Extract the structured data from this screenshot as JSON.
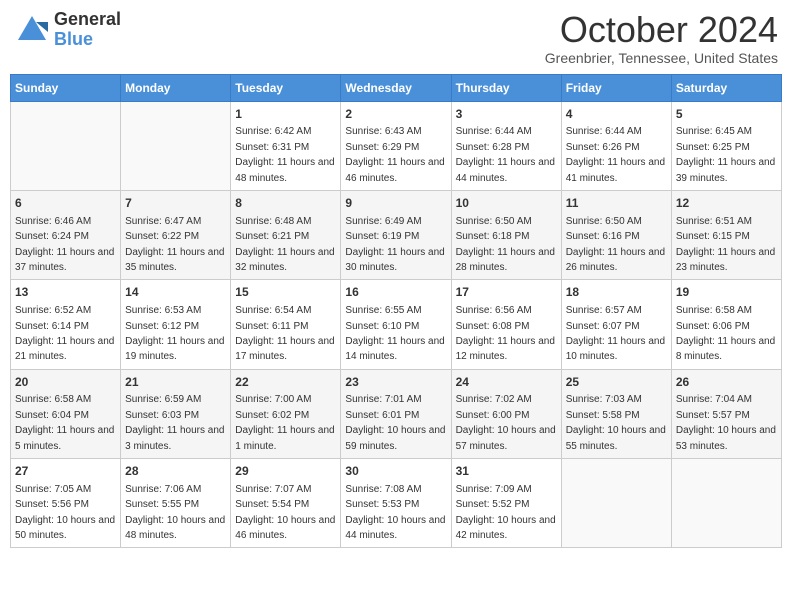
{
  "header": {
    "logo": {
      "general": "General",
      "blue": "Blue"
    },
    "title": "October 2024",
    "location": "Greenbrier, Tennessee, United States"
  },
  "weekdays": [
    "Sunday",
    "Monday",
    "Tuesday",
    "Wednesday",
    "Thursday",
    "Friday",
    "Saturday"
  ],
  "weeks": [
    [
      {
        "day": "",
        "info": ""
      },
      {
        "day": "",
        "info": ""
      },
      {
        "day": "1",
        "info": "Sunrise: 6:42 AM\nSunset: 6:31 PM\nDaylight: 11 hours and 48 minutes."
      },
      {
        "day": "2",
        "info": "Sunrise: 6:43 AM\nSunset: 6:29 PM\nDaylight: 11 hours and 46 minutes."
      },
      {
        "day": "3",
        "info": "Sunrise: 6:44 AM\nSunset: 6:28 PM\nDaylight: 11 hours and 44 minutes."
      },
      {
        "day": "4",
        "info": "Sunrise: 6:44 AM\nSunset: 6:26 PM\nDaylight: 11 hours and 41 minutes."
      },
      {
        "day": "5",
        "info": "Sunrise: 6:45 AM\nSunset: 6:25 PM\nDaylight: 11 hours and 39 minutes."
      }
    ],
    [
      {
        "day": "6",
        "info": "Sunrise: 6:46 AM\nSunset: 6:24 PM\nDaylight: 11 hours and 37 minutes."
      },
      {
        "day": "7",
        "info": "Sunrise: 6:47 AM\nSunset: 6:22 PM\nDaylight: 11 hours and 35 minutes."
      },
      {
        "day": "8",
        "info": "Sunrise: 6:48 AM\nSunset: 6:21 PM\nDaylight: 11 hours and 32 minutes."
      },
      {
        "day": "9",
        "info": "Sunrise: 6:49 AM\nSunset: 6:19 PM\nDaylight: 11 hours and 30 minutes."
      },
      {
        "day": "10",
        "info": "Sunrise: 6:50 AM\nSunset: 6:18 PM\nDaylight: 11 hours and 28 minutes."
      },
      {
        "day": "11",
        "info": "Sunrise: 6:50 AM\nSunset: 6:16 PM\nDaylight: 11 hours and 26 minutes."
      },
      {
        "day": "12",
        "info": "Sunrise: 6:51 AM\nSunset: 6:15 PM\nDaylight: 11 hours and 23 minutes."
      }
    ],
    [
      {
        "day": "13",
        "info": "Sunrise: 6:52 AM\nSunset: 6:14 PM\nDaylight: 11 hours and 21 minutes."
      },
      {
        "day": "14",
        "info": "Sunrise: 6:53 AM\nSunset: 6:12 PM\nDaylight: 11 hours and 19 minutes."
      },
      {
        "day": "15",
        "info": "Sunrise: 6:54 AM\nSunset: 6:11 PM\nDaylight: 11 hours and 17 minutes."
      },
      {
        "day": "16",
        "info": "Sunrise: 6:55 AM\nSunset: 6:10 PM\nDaylight: 11 hours and 14 minutes."
      },
      {
        "day": "17",
        "info": "Sunrise: 6:56 AM\nSunset: 6:08 PM\nDaylight: 11 hours and 12 minutes."
      },
      {
        "day": "18",
        "info": "Sunrise: 6:57 AM\nSunset: 6:07 PM\nDaylight: 11 hours and 10 minutes."
      },
      {
        "day": "19",
        "info": "Sunrise: 6:58 AM\nSunset: 6:06 PM\nDaylight: 11 hours and 8 minutes."
      }
    ],
    [
      {
        "day": "20",
        "info": "Sunrise: 6:58 AM\nSunset: 6:04 PM\nDaylight: 11 hours and 5 minutes."
      },
      {
        "day": "21",
        "info": "Sunrise: 6:59 AM\nSunset: 6:03 PM\nDaylight: 11 hours and 3 minutes."
      },
      {
        "day": "22",
        "info": "Sunrise: 7:00 AM\nSunset: 6:02 PM\nDaylight: 11 hours and 1 minute."
      },
      {
        "day": "23",
        "info": "Sunrise: 7:01 AM\nSunset: 6:01 PM\nDaylight: 10 hours and 59 minutes."
      },
      {
        "day": "24",
        "info": "Sunrise: 7:02 AM\nSunset: 6:00 PM\nDaylight: 10 hours and 57 minutes."
      },
      {
        "day": "25",
        "info": "Sunrise: 7:03 AM\nSunset: 5:58 PM\nDaylight: 10 hours and 55 minutes."
      },
      {
        "day": "26",
        "info": "Sunrise: 7:04 AM\nSunset: 5:57 PM\nDaylight: 10 hours and 53 minutes."
      }
    ],
    [
      {
        "day": "27",
        "info": "Sunrise: 7:05 AM\nSunset: 5:56 PM\nDaylight: 10 hours and 50 minutes."
      },
      {
        "day": "28",
        "info": "Sunrise: 7:06 AM\nSunset: 5:55 PM\nDaylight: 10 hours and 48 minutes."
      },
      {
        "day": "29",
        "info": "Sunrise: 7:07 AM\nSunset: 5:54 PM\nDaylight: 10 hours and 46 minutes."
      },
      {
        "day": "30",
        "info": "Sunrise: 7:08 AM\nSunset: 5:53 PM\nDaylight: 10 hours and 44 minutes."
      },
      {
        "day": "31",
        "info": "Sunrise: 7:09 AM\nSunset: 5:52 PM\nDaylight: 10 hours and 42 minutes."
      },
      {
        "day": "",
        "info": ""
      },
      {
        "day": "",
        "info": ""
      }
    ]
  ]
}
